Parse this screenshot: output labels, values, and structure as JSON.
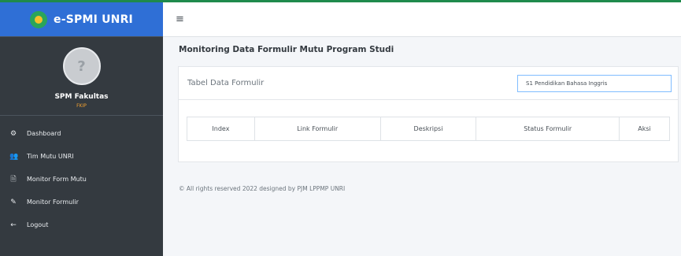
{
  "brand": {
    "title": "e-SPMI UNRI"
  },
  "user": {
    "name": "SPM Fakultas",
    "subtitle": "FKIP",
    "avatar_glyph": "?"
  },
  "sidebar": {
    "items": [
      {
        "label": "Dashboard",
        "icon": "dashboard-icon",
        "glyph": "⚙"
      },
      {
        "label": "Tim Mutu UNRI",
        "icon": "users-icon",
        "glyph": "👥"
      },
      {
        "label": "Monitor Form Mutu",
        "icon": "file-icon",
        "glyph": "🗎"
      },
      {
        "label": "Monitor Formulir",
        "icon": "edit-icon",
        "glyph": "✎"
      },
      {
        "label": "Logout",
        "icon": "arrow-left-icon",
        "glyph": "←"
      }
    ]
  },
  "topbar": {
    "menu_glyph": "≡"
  },
  "main": {
    "title": "Monitoring Data Formulir Mutu Program Studi",
    "card_title": "Tabel Data Formulir",
    "select_value": "S1 Pendidikan Bahasa Inggris",
    "table_headers": [
      "Index",
      "Link Formulir",
      "Deskripsi",
      "Status Formulir",
      "Aksi"
    ]
  },
  "footer": {
    "text": "© All rights reserved 2022 designed by PJM LPPMP UNRI"
  },
  "colors": {
    "brand": "#2f6fd6",
    "sidebar": "#343a40",
    "accent": "#f0a030"
  }
}
